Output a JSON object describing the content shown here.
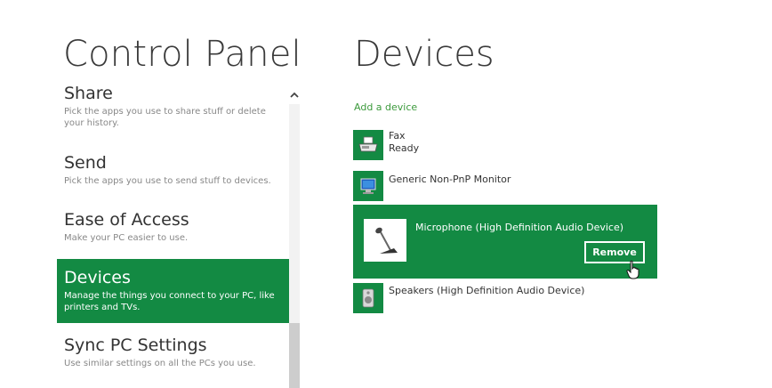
{
  "left_panel": {
    "title": "Control Panel",
    "items": [
      {
        "label": "Share",
        "desc": "Pick the apps you use to share stuff or delete your history.",
        "selected": false
      },
      {
        "label": "Send",
        "desc": "Pick the apps you use to send stuff to devices.",
        "selected": false
      },
      {
        "label": "Ease of Access",
        "desc": "Make your PC easier to use.",
        "selected": false
      },
      {
        "label": "Devices",
        "desc": "Manage the things you connect to your PC, like printers and TVs.",
        "selected": true
      },
      {
        "label": "Sync PC Settings",
        "desc": "Use similar settings on all the PCs you use.",
        "selected": false
      }
    ]
  },
  "right_panel": {
    "title": "Devices",
    "add_device": "Add a device",
    "devices": [
      {
        "name": "Fax",
        "status": "Ready",
        "icon": "fax-icon"
      },
      {
        "name": "Generic Non-PnP Monitor",
        "status": "",
        "icon": "monitor-icon"
      },
      {
        "name": "Microphone (High Definition Audio Device)",
        "status": "",
        "icon": "microphone-icon",
        "expanded": true,
        "action": "Remove"
      },
      {
        "name": "Speakers (High Definition Audio Device)",
        "status": "",
        "icon": "speaker-icon"
      }
    ]
  },
  "colors": {
    "accent": "#138a43",
    "link": "#3c9a3c",
    "text": "#333333",
    "muted": "#888888"
  }
}
